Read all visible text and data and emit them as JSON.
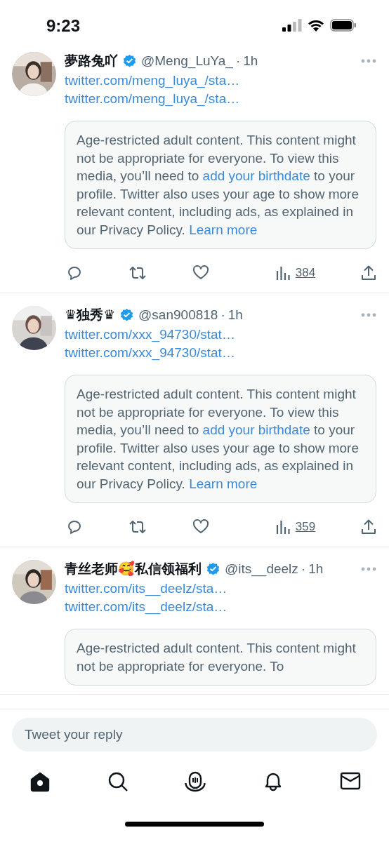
{
  "status_bar": {
    "time": "9:23"
  },
  "tweets": [
    {
      "name": "夢路兔吖",
      "verified": true,
      "handle": "@Meng_LuYa_",
      "separator": "·",
      "time": "1h",
      "links": [
        "twitter.com/meng_luya_/sta…",
        "twitter.com/meng_luya_/sta…"
      ],
      "notice": [
        {
          "text": "Age-restricted adult content. This content might not be appropriate for everyone. To view this media, you’ll need to ",
          "link": false
        },
        {
          "text": "add your birthdate",
          "link": true
        },
        {
          "text": " to your profile. Twitter also uses your age to show more relevant content, including ads, as explained in our Privacy Policy. ",
          "link": false
        },
        {
          "text": "Learn more",
          "link": true
        }
      ],
      "views": "384"
    },
    {
      "name": "♛独秀♛",
      "verified": true,
      "handle": "@san900818",
      "separator": "·",
      "time": "1h",
      "links": [
        "twitter.com/xxx_94730/stat…",
        "twitter.com/xxx_94730/stat…"
      ],
      "notice": [
        {
          "text": "Age-restricted adult content. This content might not be appropriate for everyone. To view this media, you’ll need to ",
          "link": false
        },
        {
          "text": "add your birthdate",
          "link": true
        },
        {
          "text": " to your profile. Twitter also uses your age to show more relevant content, including ads, as explained in our Privacy Policy. ",
          "link": false
        },
        {
          "text": "Learn more",
          "link": true
        }
      ],
      "views": "359"
    },
    {
      "name": "青丝老师🥰私信领福利",
      "verified": true,
      "handle": "@its__deelz",
      "separator": "·",
      "time": "1h",
      "links": [
        "twitter.com/its__deelz/sta…",
        "twitter.com/its__deelz/sta…"
      ],
      "notice": [
        {
          "text": "Age-restricted adult content. This content might not be appropriate for everyone. To",
          "link": false
        }
      ]
    }
  ],
  "reply": {
    "placeholder": "Tweet your reply"
  },
  "nav": [
    {
      "kind": "home",
      "selected": true
    },
    {
      "kind": "search",
      "selected": false
    },
    {
      "kind": "spaces",
      "selected": false
    },
    {
      "kind": "notifications",
      "selected": false
    },
    {
      "kind": "messages",
      "selected": false
    }
  ]
}
